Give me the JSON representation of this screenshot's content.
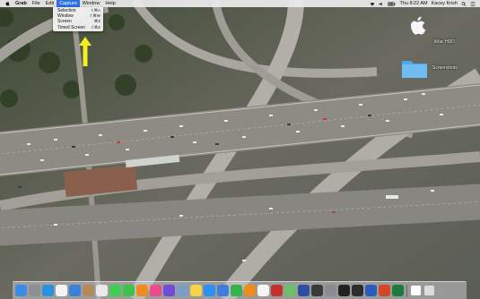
{
  "menubar": {
    "app_name": "Grab",
    "items": [
      "File",
      "Edit",
      "Capture",
      "Window",
      "Help"
    ],
    "active_item": "Capture",
    "clock": "Thu 8:22 AM",
    "user": "Kacey Krish"
  },
  "capture_menu": {
    "items": [
      {
        "label": "Selection",
        "shortcut": "⇧⌘A"
      },
      {
        "label": "Window",
        "shortcut": "⇧⌘W"
      },
      {
        "label": "Screen",
        "shortcut": "⌘Z"
      },
      {
        "label": "Timed Screen",
        "shortcut": "⇧⌘Z"
      }
    ]
  },
  "desktop": {
    "icons": [
      {
        "label": "iMac HDD",
        "icon": "apple-drive-icon"
      },
      {
        "label": "Screenshots",
        "icon": "folder-icon"
      }
    ]
  },
  "annotation": {
    "arrow_color": "#f3ee21"
  },
  "dock": {
    "apps": [
      {
        "name": "finder-icon",
        "color": "#3d8ae8"
      },
      {
        "name": "launchpad-icon",
        "color": "#8e8e95"
      },
      {
        "name": "safari-icon",
        "color": "#2a90e0"
      },
      {
        "name": "calendar-icon",
        "color": "#f3f3f3"
      },
      {
        "name": "mail-icon",
        "color": "#3a7fd8"
      },
      {
        "name": "contacts-icon",
        "color": "#b48a5c"
      },
      {
        "name": "photos-icon",
        "color": "#e9e9e9"
      },
      {
        "name": "messages-icon",
        "color": "#3ecf52"
      },
      {
        "name": "facetime-icon",
        "color": "#3fc24d"
      },
      {
        "name": "ibooks-icon",
        "color": "#f28b1f"
      },
      {
        "name": "itunes-icon",
        "color": "#ea4c89"
      },
      {
        "name": "imovie-icon",
        "color": "#6e4bd8"
      },
      {
        "name": "preview-icon",
        "color": "#7a9ec4"
      },
      {
        "name": "notes-icon",
        "color": "#f6d34a"
      },
      {
        "name": "app-store-icon",
        "color": "#2f8ff0"
      },
      {
        "name": "keynote-icon",
        "color": "#3d7de0"
      },
      {
        "name": "numbers-icon",
        "color": "#35b24a"
      },
      {
        "name": "pages-icon",
        "color": "#f08c1e"
      },
      {
        "name": "chrome-icon",
        "color": "#f5f5f5"
      },
      {
        "name": "photo-booth-icon",
        "color": "#c4312c"
      },
      {
        "name": "maps-icon",
        "color": "#6cbf6a"
      },
      {
        "name": "grapher-icon",
        "color": "#2c4fa3"
      },
      {
        "name": "dashboard-icon",
        "color": "#3a3a3a"
      },
      {
        "name": "system-preferences-icon",
        "color": "#8b8b91"
      },
      {
        "name": "terminal-icon",
        "color": "#222222"
      },
      {
        "name": "activity-monitor-icon",
        "color": "#2d2d2d"
      },
      {
        "name": "word-icon",
        "color": "#2b5cb8"
      },
      {
        "name": "powerpoint-icon",
        "color": "#d24726"
      },
      {
        "name": "excel-icon",
        "color": "#1f7a40"
      }
    ],
    "trailing": [
      {
        "name": "downloads-stack-icon",
        "color": "#ffffff"
      },
      {
        "name": "trash-icon",
        "color": "#dcdcdc"
      }
    ]
  }
}
